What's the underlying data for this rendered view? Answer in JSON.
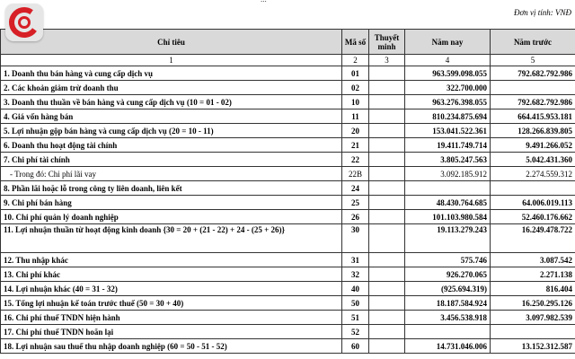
{
  "header": {
    "unit": "Đơn vị tính: VNĐ",
    "top_fragment": "..."
  },
  "table": {
    "columns": [
      "Chỉ tiêu",
      "Mã số",
      "Thuyết minh",
      "Năm nay",
      "Năm trước"
    ],
    "index_row": [
      "1",
      "2",
      "3",
      "4",
      "5"
    ],
    "rows": [
      {
        "name": "1. Doanh thu bán hàng và cung cấp dịch vụ",
        "code": "01",
        "note": "",
        "current": "963.599.098.055",
        "previous": "792.682.792.986"
      },
      {
        "name": "2. Các khoản giảm trừ doanh thu",
        "code": "02",
        "note": "",
        "current": "322.700.000",
        "previous": ""
      },
      {
        "name": "3. Doanh thu thuần về bán hàng và cung cấp dịch vụ (10 = 01 - 02)",
        "code": "10",
        "note": "",
        "current": "963.276.398.055",
        "previous": "792.682.792.986"
      },
      {
        "name": "4. Giá vốn hàng bán",
        "code": "11",
        "note": "",
        "current": "810.234.875.694",
        "previous": "664.415.953.181"
      },
      {
        "name": "5. Lợi nhuận gộp bán hàng và cung cấp dịch vụ (20 = 10 - 11)",
        "code": "20",
        "note": "",
        "current": "153.041.522.361",
        "previous": "128.266.839.805"
      },
      {
        "name": "6. Doanh thu hoạt động tài chính",
        "code": "21",
        "note": "",
        "current": "19.411.749.714",
        "previous": "9.491.266.052"
      },
      {
        "name": "7. Chi phí tài chính",
        "code": "22",
        "note": "",
        "current": "3.805.247.563",
        "previous": "5.042.431.360"
      },
      {
        "name": "- Trong đó: Chi phí lãi vay",
        "code": "22B",
        "note": "",
        "current": "3.092.185.912",
        "previous": "2.274.559.312",
        "sub": true
      },
      {
        "name": "8. Phần lãi hoặc lỗ trong công ty liên doanh, liên kết",
        "code": "24",
        "note": "",
        "current": "",
        "previous": ""
      },
      {
        "name": "9. Chi phí bán hàng",
        "code": "25",
        "note": "",
        "current": "48.430.764.685",
        "previous": "64.006.019.113"
      },
      {
        "name": "10. Chi phí quản lý doanh nghiệp",
        "code": "26",
        "note": "",
        "current": "101.103.980.584",
        "previous": "52.460.176.662"
      },
      {
        "name": "11. Lợi nhuận thuần từ hoạt động kinh doanh {30 = 20 + (21 - 22) + 24 - (25 + 26)}",
        "code": "30",
        "note": "",
        "current": "19.113.279.243",
        "previous": "16.249.478.722",
        "tall": true
      },
      {
        "name": "12. Thu nhập khác",
        "code": "31",
        "note": "",
        "current": "575.746",
        "previous": "3.087.542"
      },
      {
        "name": "13. Chi phí khác",
        "code": "32",
        "note": "",
        "current": "926.270.065",
        "previous": "2.271.138"
      },
      {
        "name": "14. Lợi nhuận khác (40 = 31 - 32)",
        "code": "40",
        "note": "",
        "current": "(925.694.319)",
        "previous": "816.404"
      },
      {
        "name": "15. Tổng lợi nhuận kế toán trước thuế (50 = 30 + 40)",
        "code": "50",
        "note": "",
        "current": "18.187.584.924",
        "previous": "16.250.295.126"
      },
      {
        "name": "16. Chi phí thuế TNDN hiện hành",
        "code": "51",
        "note": "",
        "current": "3.456.538.918",
        "previous": "3.097.982.539"
      },
      {
        "name": "17. Chi phí thuế TNDN hoãn lại",
        "code": "52",
        "note": "",
        "current": "",
        "previous": ""
      },
      {
        "name": "18. Lợi nhuận sau thuế thu nhập doanh nghiệp (60 = 50 - 51 - 52)",
        "code": "60",
        "note": "",
        "current": "14.731.046.006",
        "previous": "13.152.312.587"
      }
    ]
  },
  "icons": {
    "logo": "red-c-logo-icon"
  },
  "colors": {
    "header_bg": "#d9d9d9",
    "logo_red": "#d71f26"
  }
}
